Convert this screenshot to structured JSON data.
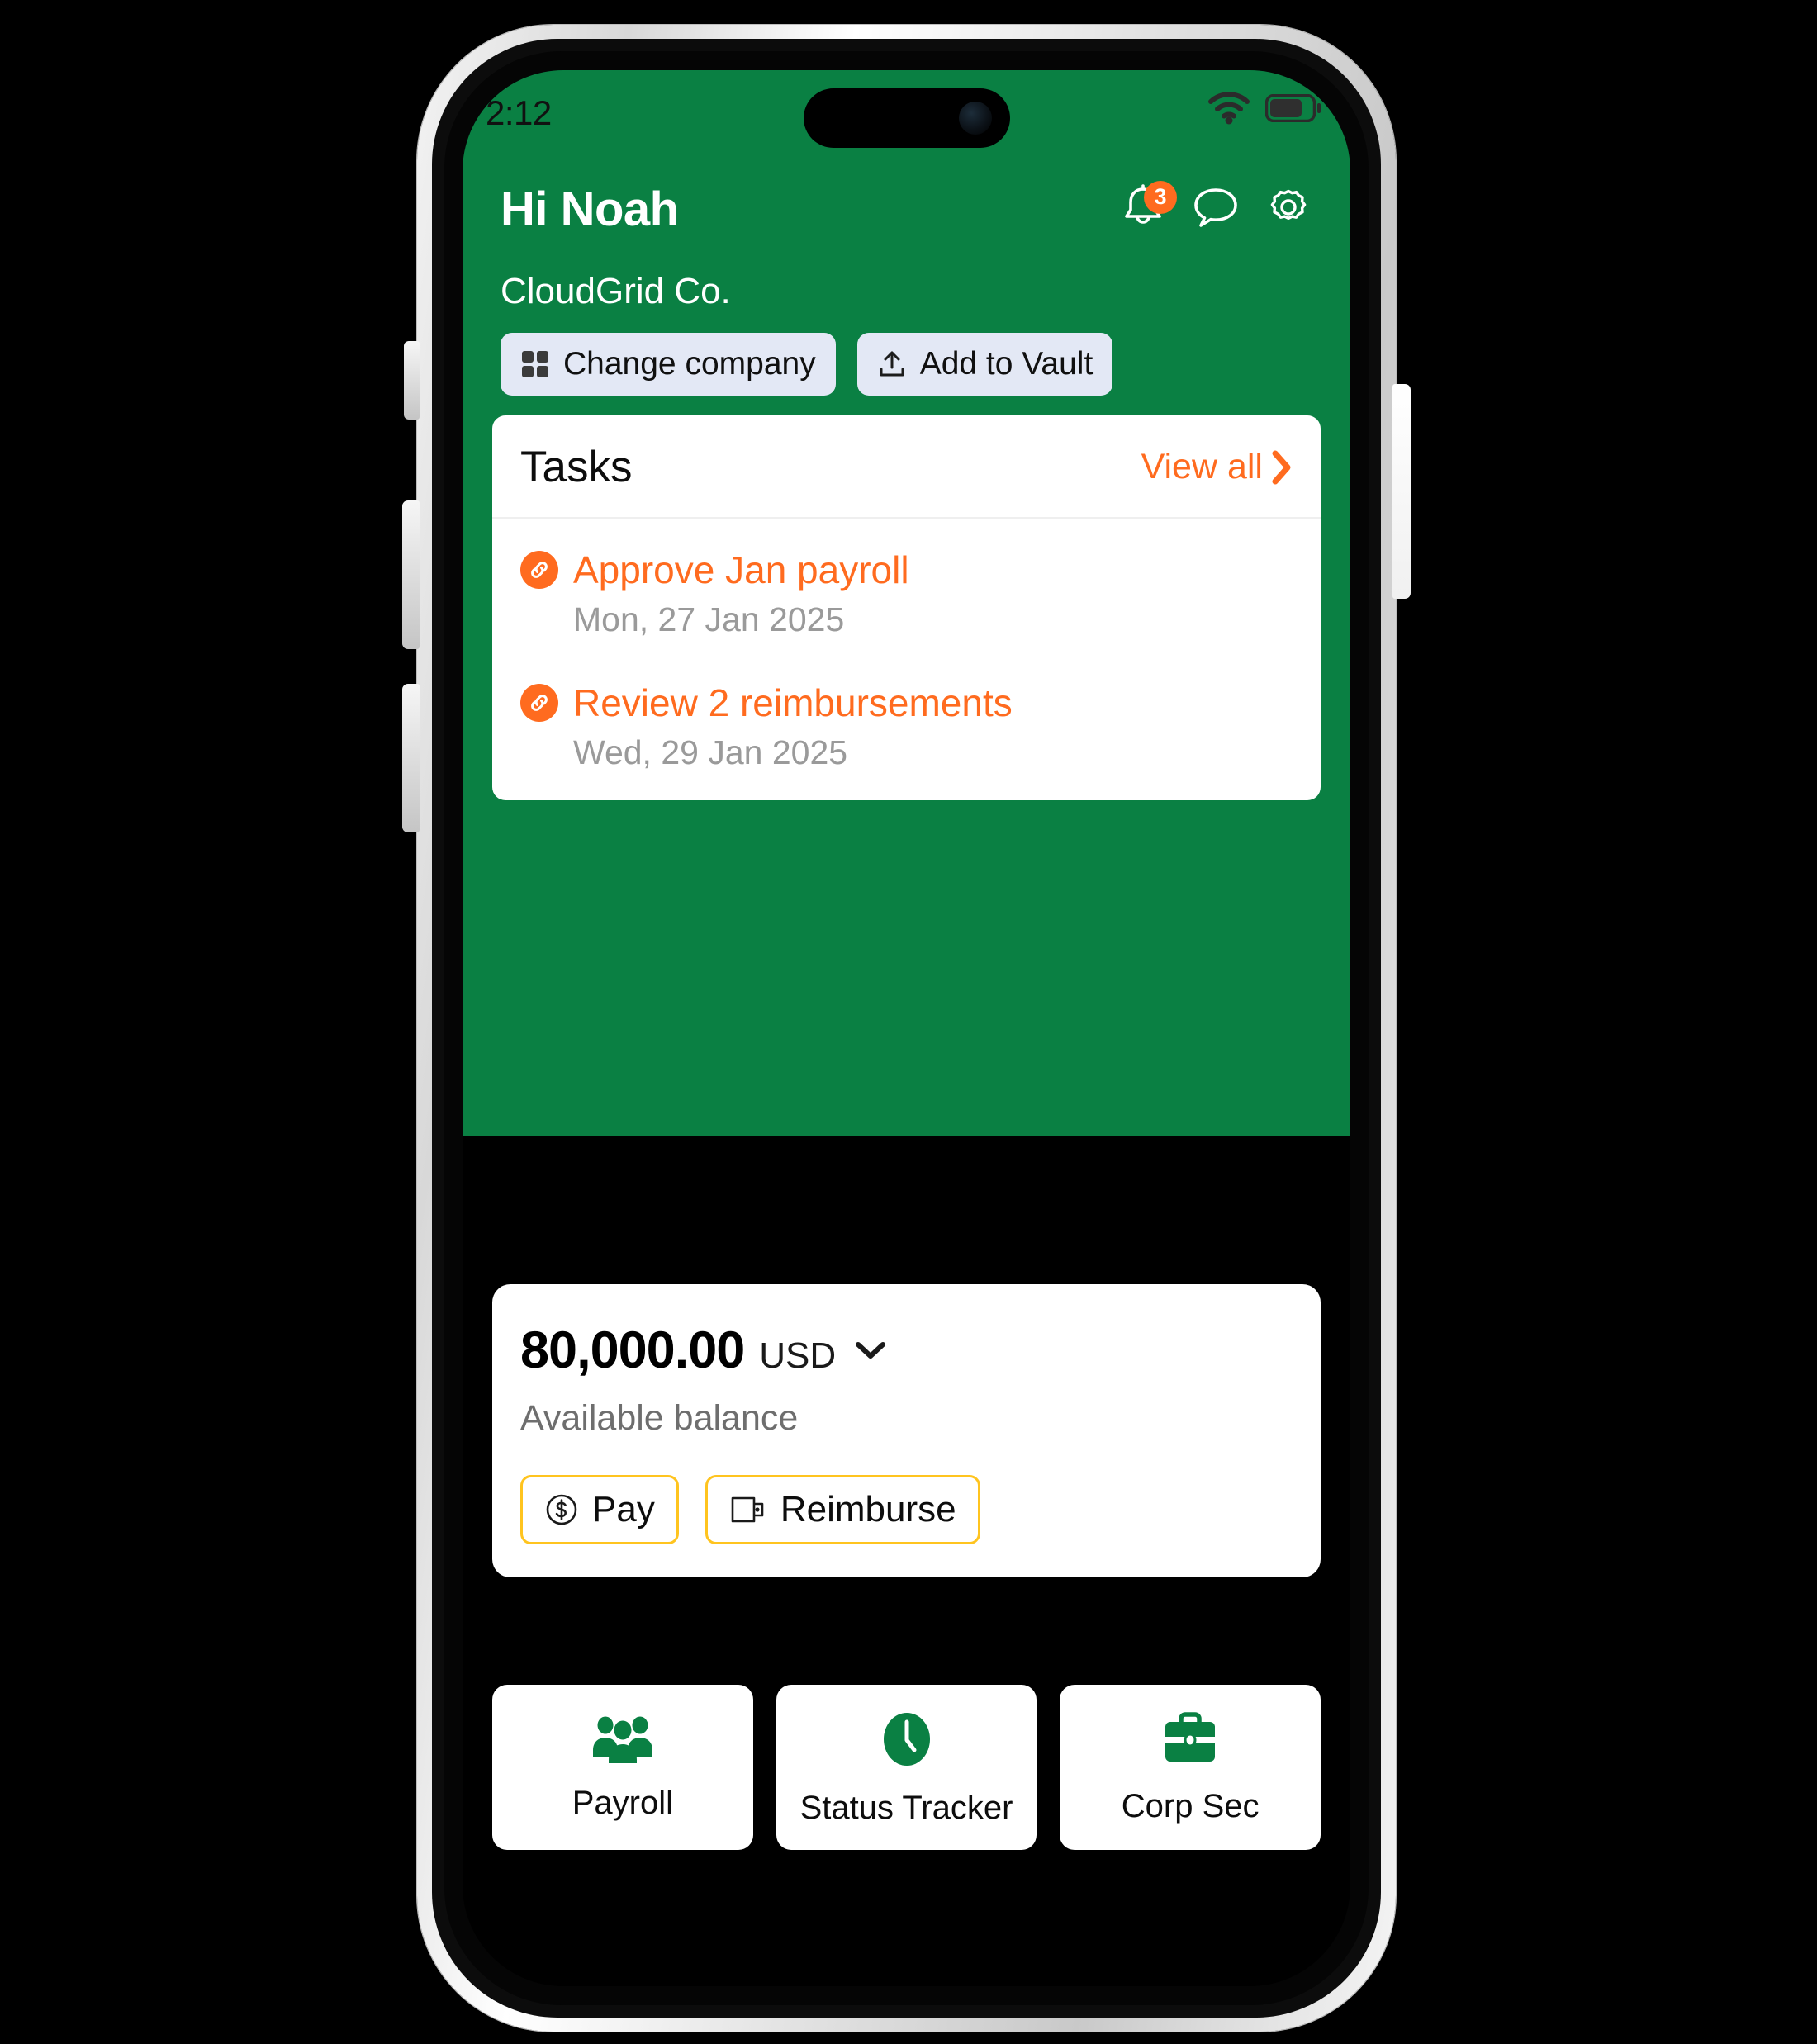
{
  "status_bar": {
    "time": "2:12",
    "wifi_icon": "wifi-icon",
    "battery_icon": "battery-icon"
  },
  "header": {
    "greeting": "Hi Noah",
    "company": "CloudGrid Co.",
    "icons": {
      "notifications": "bell-icon",
      "notifications_count": "3",
      "messages": "chat-bubble-icon",
      "settings": "gear-icon"
    },
    "chips": [
      {
        "label": "Change company",
        "icon": "grid-icon"
      },
      {
        "label": "Add to Vault",
        "icon": "upload-icon"
      }
    ]
  },
  "tasks": {
    "title": "Tasks",
    "view_all": "View all",
    "chevron_icon": "chevron-right-icon",
    "items": [
      {
        "name": "Approve Jan payroll",
        "date": "Mon, 27 Jan 2025",
        "icon": "link-icon"
      },
      {
        "name": "Review 2 reimbursements",
        "date": "Wed, 29 Jan 2025",
        "icon": "link-icon"
      }
    ]
  },
  "balance": {
    "amount": "80,000.00",
    "currency": "USD",
    "caret_icon": "chevron-down-icon",
    "label": "Available balance",
    "actions": [
      {
        "label": "Pay",
        "icon": "dollar-circle-icon"
      },
      {
        "label": "Reimburse",
        "icon": "wallet-icon"
      }
    ]
  },
  "tiles": [
    {
      "label": "Payroll",
      "icon": "people-group-icon"
    },
    {
      "label": "Status Tracker",
      "icon": "clock-icon"
    },
    {
      "label": "Corp Sec",
      "icon": "briefcase-icon"
    }
  ],
  "colors": {
    "brand_green": "#0a8043",
    "accent_orange": "#ff6b1f",
    "accent_yellow": "#ffc41f",
    "chip_bg": "#e3e8f5"
  }
}
